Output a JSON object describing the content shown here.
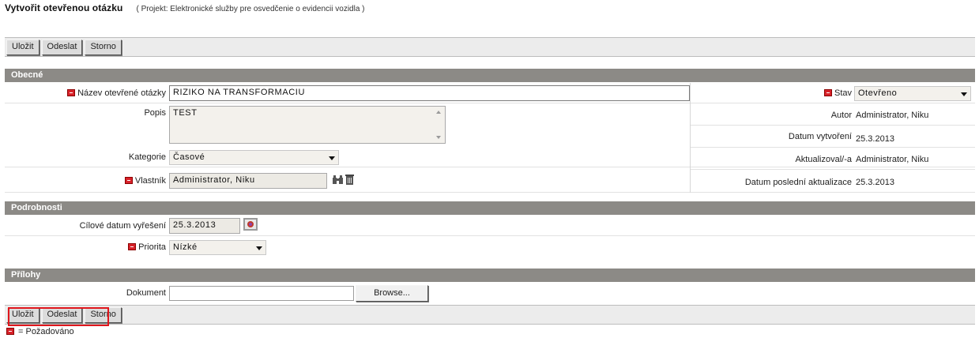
{
  "header": {
    "title": "Vytvořit otevřenou otázku",
    "project": "( Projekt: Elektronické služby pre osvedčenie o evidencii vozidla )"
  },
  "toolbar": {
    "save": "Uložit",
    "send": "Odeslat",
    "cancel": "Storno"
  },
  "sections": {
    "general": "Obecné",
    "details": "Podrobnosti",
    "attachments": "Přílohy"
  },
  "general": {
    "name_label": "Název otevřené otázky",
    "name_value": "RIZIKO NA TRANSFORMACIU",
    "description_label": "Popis",
    "description_value": "TEST",
    "category_label": "Kategorie",
    "category_value": "Časové",
    "owner_label": "Vlastník",
    "owner_value": "Administrator, Niku",
    "state_label": "Stav",
    "state_value": "Otevřeno",
    "author_label": "Autor",
    "author_value": "Administrator, Niku",
    "created_label": "Datum vytvoření",
    "created_value": "25.3.2013",
    "updated_by_label": "Aktualizoval/-a",
    "updated_by_value": "Administrator, Niku",
    "last_update_label": "Datum poslední aktualizace",
    "last_update_value": "25.3.2013"
  },
  "details": {
    "target_date_label": "Cílové datum vyřešení",
    "target_date_value": "25.3.2013",
    "priority_label": "Priorita",
    "priority_value": "Nízké"
  },
  "attachments": {
    "document_label": "Dokument",
    "document_value": "",
    "browse_label": "Browse..."
  },
  "footer": {
    "required_note": "= Požadováno"
  }
}
